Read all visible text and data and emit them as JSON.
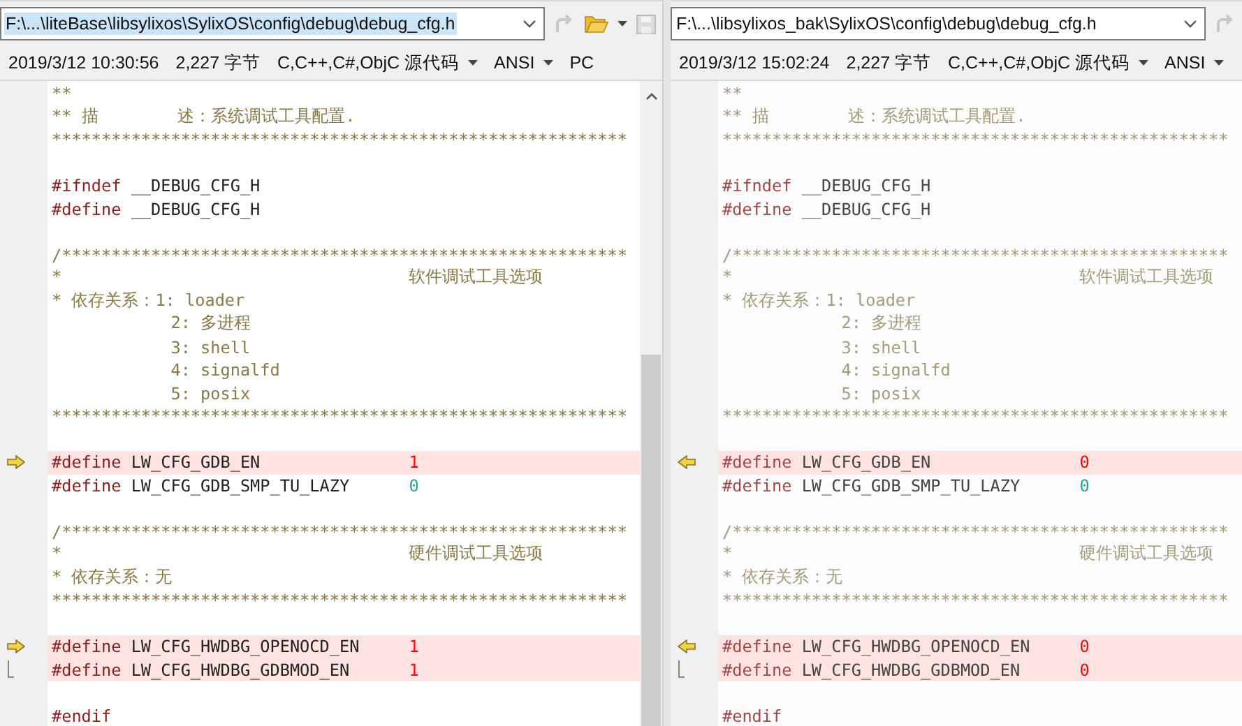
{
  "panes": [
    {
      "path": "F:\\...\\liteBase\\libsylixos\\SylixOS\\config\\debug\\debug_cfg.h",
      "path_selected": true,
      "focused": true,
      "modified": "2019/3/12 10:30:56",
      "size": "2,227 字节",
      "format": "C,C++,C#,ObjC 源代码",
      "encoding": "ANSI",
      "line_ending": "PC",
      "lines": [
        {
          "kind": "plain",
          "changed": false,
          "segments": [
            {
              "kind": "comment",
              "text": "**"
            }
          ]
        },
        {
          "kind": "plain",
          "changed": false,
          "segments": [
            {
              "kind": "comment",
              "text": "** 描        述：系统调试工具配置."
            }
          ]
        },
        {
          "kind": "plain",
          "changed": false,
          "segments": [
            {
              "kind": "comment",
              "text": "**********************************************************"
            }
          ]
        },
        {
          "kind": "plain",
          "changed": false
        },
        {
          "kind": "plain",
          "changed": false,
          "segments": [
            {
              "kind": "directive",
              "text": "#ifndef"
            },
            {
              "kind": "name",
              "text": " __DEBUG_CFG_H"
            }
          ]
        },
        {
          "kind": "plain",
          "changed": false,
          "segments": [
            {
              "kind": "directive",
              "text": "#define"
            },
            {
              "kind": "name",
              "text": " __DEBUG_CFG_H"
            }
          ]
        },
        {
          "kind": "plain",
          "changed": false
        },
        {
          "kind": "plain",
          "changed": false,
          "segments": [
            {
              "kind": "comment",
              "text": "/*********************************************************"
            }
          ]
        },
        {
          "kind": "plain",
          "changed": false,
          "segments": [
            {
              "kind": "comment",
              "text": "*                                   软件调试工具选项"
            }
          ]
        },
        {
          "kind": "plain",
          "changed": false,
          "segments": [
            {
              "kind": "comment",
              "text": "* 依存关系：1: loader"
            }
          ]
        },
        {
          "kind": "plain",
          "changed": false,
          "segments": [
            {
              "kind": "comment",
              "text": "            2: 多进程"
            }
          ]
        },
        {
          "kind": "plain",
          "changed": false,
          "segments": [
            {
              "kind": "comment",
              "text": "            3: shell"
            }
          ]
        },
        {
          "kind": "plain",
          "changed": false,
          "segments": [
            {
              "kind": "comment",
              "text": "            4: signalfd"
            }
          ]
        },
        {
          "kind": "plain",
          "changed": false,
          "segments": [
            {
              "kind": "comment",
              "text": "            5: posix"
            }
          ]
        },
        {
          "kind": "plain",
          "changed": false,
          "segments": [
            {
              "kind": "comment",
              "text": "**********************************************************"
            }
          ]
        },
        {
          "kind": "plain",
          "changed": false
        },
        {
          "kind": "diff_start",
          "changed": true,
          "segments": [
            {
              "kind": "directive",
              "text": "#define"
            },
            {
              "kind": "name",
              "text": " LW_CFG_GDB_EN               "
            },
            {
              "kind": "number",
              "text": "1"
            }
          ]
        },
        {
          "kind": "plain",
          "changed": false,
          "segments": [
            {
              "kind": "directive",
              "text": "#define"
            },
            {
              "kind": "name",
              "text": " LW_CFG_GDB_SMP_TU_LAZY      "
            },
            {
              "kind": "number",
              "text": "0"
            }
          ]
        },
        {
          "kind": "plain",
          "changed": false
        },
        {
          "kind": "plain",
          "changed": false,
          "segments": [
            {
              "kind": "comment",
              "text": "/*********************************************************"
            }
          ]
        },
        {
          "kind": "plain",
          "changed": false,
          "segments": [
            {
              "kind": "comment",
              "text": "*                                   硬件调试工具选项"
            }
          ]
        },
        {
          "kind": "plain",
          "changed": false,
          "segments": [
            {
              "kind": "comment",
              "text": "* 依存关系：无"
            }
          ]
        },
        {
          "kind": "plain",
          "changed": false,
          "segments": [
            {
              "kind": "comment",
              "text": "**********************************************************"
            }
          ]
        },
        {
          "kind": "plain",
          "changed": false
        },
        {
          "kind": "diff_start",
          "changed": true,
          "segments": [
            {
              "kind": "directive",
              "text": "#define"
            },
            {
              "kind": "name",
              "text": " LW_CFG_HWDBG_OPENOCD_EN     "
            },
            {
              "kind": "number",
              "text": "1"
            }
          ]
        },
        {
          "kind": "diff_continue",
          "changed": true,
          "segments": [
            {
              "kind": "directive",
              "text": "#define"
            },
            {
              "kind": "name",
              "text": " LW_CFG_HWDBG_GDBMOD_EN      "
            },
            {
              "kind": "number",
              "text": "1"
            }
          ]
        },
        {
          "kind": "plain",
          "changed": false
        },
        {
          "kind": "plain",
          "changed": false,
          "segments": [
            {
              "kind": "directive",
              "text": "#endif"
            }
          ]
        }
      ]
    },
    {
      "path": "F:\\...\\libsylixos_bak\\SylixOS\\config\\debug\\debug_cfg.h",
      "path_selected": false,
      "focused": false,
      "modified": "2019/3/12 15:02:24",
      "size": "2,227 字节",
      "format": "C,C++,C#,ObjC 源代码",
      "encoding": "ANSI",
      "lines": [
        {
          "kind": "plain",
          "changed": false,
          "segments": [
            {
              "kind": "comment",
              "text": "**"
            }
          ]
        },
        {
          "kind": "plain",
          "changed": false,
          "segments": [
            {
              "kind": "comment",
              "text": "** 描        述：系统调试工具配置."
            }
          ]
        },
        {
          "kind": "plain",
          "changed": false,
          "segments": [
            {
              "kind": "comment",
              "text": "***************************************************"
            }
          ]
        },
        {
          "kind": "plain",
          "changed": false
        },
        {
          "kind": "plain",
          "changed": false,
          "segments": [
            {
              "kind": "directive",
              "text": "#ifndef"
            },
            {
              "kind": "name",
              "text": " __DEBUG_CFG_H"
            }
          ]
        },
        {
          "kind": "plain",
          "changed": false,
          "segments": [
            {
              "kind": "directive",
              "text": "#define"
            },
            {
              "kind": "name",
              "text": " __DEBUG_CFG_H"
            }
          ]
        },
        {
          "kind": "plain",
          "changed": false
        },
        {
          "kind": "plain",
          "changed": false,
          "segments": [
            {
              "kind": "comment",
              "text": "/**************************************************"
            }
          ]
        },
        {
          "kind": "plain",
          "changed": false,
          "segments": [
            {
              "kind": "comment",
              "text": "*                                   软件调试工具选项"
            }
          ]
        },
        {
          "kind": "plain",
          "changed": false,
          "segments": [
            {
              "kind": "comment",
              "text": "* 依存关系：1: loader"
            }
          ]
        },
        {
          "kind": "plain",
          "changed": false,
          "segments": [
            {
              "kind": "comment",
              "text": "            2: 多进程"
            }
          ]
        },
        {
          "kind": "plain",
          "changed": false,
          "segments": [
            {
              "kind": "comment",
              "text": "            3: shell"
            }
          ]
        },
        {
          "kind": "plain",
          "changed": false,
          "segments": [
            {
              "kind": "comment",
              "text": "            4: signalfd"
            }
          ]
        },
        {
          "kind": "plain",
          "changed": false,
          "segments": [
            {
              "kind": "comment",
              "text": "            5: posix"
            }
          ]
        },
        {
          "kind": "plain",
          "changed": false,
          "segments": [
            {
              "kind": "comment",
              "text": "***************************************************"
            }
          ]
        },
        {
          "kind": "plain",
          "changed": false
        },
        {
          "kind": "diff_start",
          "changed": true,
          "segments": [
            {
              "kind": "directive",
              "text": "#define"
            },
            {
              "kind": "name",
              "text": " LW_CFG_GDB_EN               "
            },
            {
              "kind": "number",
              "text": "0"
            }
          ]
        },
        {
          "kind": "plain",
          "changed": false,
          "segments": [
            {
              "kind": "directive",
              "text": "#define"
            },
            {
              "kind": "name",
              "text": " LW_CFG_GDB_SMP_TU_LAZY      "
            },
            {
              "kind": "number",
              "text": "0"
            }
          ]
        },
        {
          "kind": "plain",
          "changed": false
        },
        {
          "kind": "plain",
          "changed": false,
          "segments": [
            {
              "kind": "comment",
              "text": "/**************************************************"
            }
          ]
        },
        {
          "kind": "plain",
          "changed": false,
          "segments": [
            {
              "kind": "comment",
              "text": "*                                   硬件调试工具选项"
            }
          ]
        },
        {
          "kind": "plain",
          "changed": false,
          "segments": [
            {
              "kind": "comment",
              "text": "* 依存关系：无"
            }
          ]
        },
        {
          "kind": "plain",
          "changed": false,
          "segments": [
            {
              "kind": "comment",
              "text": "***************************************************"
            }
          ]
        },
        {
          "kind": "plain",
          "changed": false
        },
        {
          "kind": "diff_start",
          "changed": true,
          "segments": [
            {
              "kind": "directive",
              "text": "#define"
            },
            {
              "kind": "name",
              "text": " LW_CFG_HWDBG_OPENOCD_EN     "
            },
            {
              "kind": "number",
              "text": "0"
            }
          ]
        },
        {
          "kind": "diff_continue",
          "changed": true,
          "segments": [
            {
              "kind": "directive",
              "text": "#define"
            },
            {
              "kind": "name",
              "text": " LW_CFG_HWDBG_GDBMOD_EN      "
            },
            {
              "kind": "number",
              "text": "0"
            }
          ]
        },
        {
          "kind": "plain",
          "changed": false
        },
        {
          "kind": "plain",
          "changed": false,
          "segments": [
            {
              "kind": "directive",
              "text": "#endif"
            }
          ]
        }
      ]
    }
  ]
}
